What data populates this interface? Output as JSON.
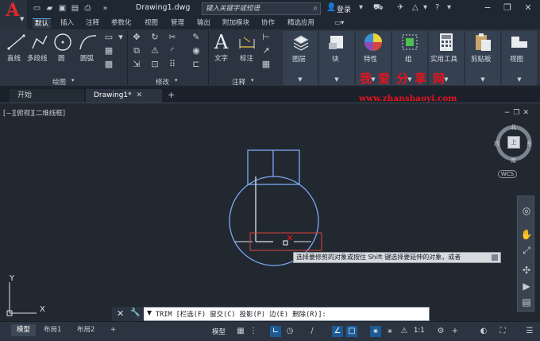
{
  "titlebar": {
    "doc_title": "Drawing1.dwg",
    "search_placeholder": "键入关键字或短语",
    "login": "登录"
  },
  "ribbon_tabs": [
    "默认",
    "插入",
    "注释",
    "参数化",
    "视图",
    "管理",
    "输出",
    "附加模块",
    "协作",
    "精选应用"
  ],
  "draw_panel": {
    "tools": [
      "直线",
      "多段线",
      "圆",
      "圆弧"
    ],
    "title": "绘图"
  },
  "modify_panel": {
    "title": "修改"
  },
  "annot_panel": {
    "tools": [
      "文字",
      "标注"
    ],
    "title": "注释"
  },
  "big_buttons": [
    "图层",
    "块",
    "特性",
    "组",
    "实用工具",
    "剪贴板",
    "视图"
  ],
  "doc_tabs": {
    "start": "开始",
    "drawing": "Drawing1*"
  },
  "watermark": {
    "cn": "我爱分享网",
    "url": "www.zhanshaoyi.com"
  },
  "viewport_label": "[−][俯视][二维线框]",
  "viewcube": {
    "north": "北",
    "south": "南",
    "east": "东",
    "west": "西",
    "top": "上",
    "wcs": "WCS"
  },
  "tooltip": "选择要修剪的对象或按住 Shift 键选择要延伸的对象，或者",
  "command": {
    "text": "TRIM [栏选(F) 窗交(C) 投影(P) 边(E) 删除(R)]:"
  },
  "layout_tabs": [
    "模型",
    "布局1",
    "布局2"
  ],
  "statusbar": {
    "model": "模型",
    "scale": "1:1"
  },
  "ucs": {
    "y": "Y",
    "x": "X"
  }
}
